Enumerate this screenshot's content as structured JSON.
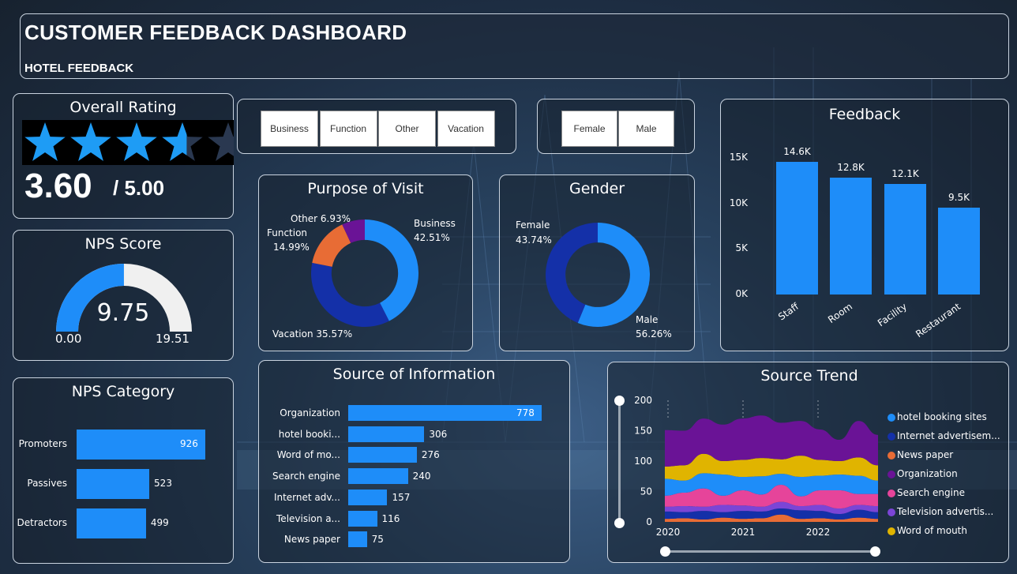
{
  "header": {
    "title": "CUSTOMER FEEDBACK DASHBOARD",
    "subtitle": "HOTEL FEEDBACK"
  },
  "overall_rating": {
    "title": "Overall Rating",
    "value_text": "3.60",
    "max_text": "/ 5.00",
    "stars": 3.6,
    "star_color": "#1e9cf5",
    "star_empty_color": "#2a3850"
  },
  "nps_score": {
    "title": "NPS Score",
    "value_text": "9.75",
    "min_text": "0.00",
    "max_text": "19.51",
    "fill_fraction": 0.4997,
    "fill_color": "#1e8df9",
    "track_color": "#f0f0f0"
  },
  "nps_category": {
    "title": "NPS Category",
    "items": [
      {
        "label": "Promoters",
        "value": 926,
        "value_text": "926"
      },
      {
        "label": "Passives",
        "value": 523,
        "value_text": "523"
      },
      {
        "label": "Detractors",
        "value": 499,
        "value_text": "499"
      }
    ]
  },
  "purpose_slicer": {
    "options": [
      "Business",
      "Function",
      "Other",
      "Vacation"
    ]
  },
  "gender_slicer": {
    "options": [
      "Female",
      "Male"
    ]
  },
  "purpose_of_visit": {
    "title": "Purpose of Visit",
    "segments": [
      {
        "name": "Business",
        "pct": 42.51,
        "label_name": "Business",
        "label_pct": "42.51%",
        "color": "#1e8df9"
      },
      {
        "name": "Vacation",
        "pct": 35.57,
        "label_name": "Vacation",
        "label_pct": "35.57%",
        "color": "#1430a8"
      },
      {
        "name": "Function",
        "pct": 14.99,
        "label_name": "Function",
        "label_pct": "14.99%",
        "color": "#e86c35"
      },
      {
        "name": "Other",
        "pct": 6.93,
        "label_name": "Other",
        "label_pct": "6.93%",
        "color": "#6a1396"
      }
    ]
  },
  "gender": {
    "title": "Gender",
    "segments": [
      {
        "name": "Male",
        "pct": 56.26,
        "label_name": "Male",
        "label_pct": "56.26%",
        "color": "#1e8df9"
      },
      {
        "name": "Female",
        "pct": 43.74,
        "label_name": "Female",
        "label_pct": "43.74%",
        "color": "#1430a8"
      }
    ]
  },
  "feedback": {
    "title": "Feedback",
    "yticks": [
      "15K",
      "10K",
      "5K",
      "0K"
    ],
    "bars": [
      {
        "category": "Staff",
        "value": 14.6,
        "label": "14.6K"
      },
      {
        "category": "Room",
        "value": 12.8,
        "label": "12.8K"
      },
      {
        "category": "Facility",
        "value": 12.1,
        "label": "12.1K"
      },
      {
        "category": "Restaurant",
        "value": 9.5,
        "label": "9.5K"
      }
    ]
  },
  "source_of_information": {
    "title": "Source of Information",
    "items": [
      {
        "label": "Organization",
        "value": 778,
        "value_text": "778"
      },
      {
        "label": "hotel booki...",
        "value": 306,
        "value_text": "306"
      },
      {
        "label": "Word of mo...",
        "value": 276,
        "value_text": "276"
      },
      {
        "label": "Search engine",
        "value": 240,
        "value_text": "240"
      },
      {
        "label": "Internet adv...",
        "value": 157,
        "value_text": "157"
      },
      {
        "label": "Television a...",
        "value": 116,
        "value_text": "116"
      },
      {
        "label": "News paper",
        "value": 75,
        "value_text": "75"
      }
    ]
  },
  "source_trend": {
    "title": "Source Trend",
    "yticks": [
      "200",
      "150",
      "100",
      "50",
      "0"
    ],
    "xticks": [
      "2020",
      "2021",
      "2022"
    ],
    "legend": [
      {
        "label": "hotel booking sites",
        "color": "#1e8df9"
      },
      {
        "label": "Internet advertisem...",
        "color": "#1430a8"
      },
      {
        "label": "News paper",
        "color": "#e86c35"
      },
      {
        "label": "Organization",
        "color": "#6a1396"
      },
      {
        "label": "Search engine",
        "color": "#e6449a"
      },
      {
        "label": "Television advertis...",
        "color": "#7b45d6"
      },
      {
        "label": "Word of mouth",
        "color": "#e0b400"
      }
    ]
  },
  "chart_data": [
    {
      "type": "bar",
      "title": "Feedback",
      "categories": [
        "Staff",
        "Room",
        "Facility",
        "Restaurant"
      ],
      "values": [
        14.6,
        12.8,
        12.1,
        9.5
      ],
      "ylim": [
        0,
        15
      ],
      "unit": "K",
      "grid": false
    },
    {
      "type": "pie",
      "title": "Purpose of Visit",
      "categories": [
        "Business",
        "Vacation",
        "Function",
        "Other"
      ],
      "values": [
        42.51,
        35.57,
        14.99,
        6.93
      ]
    },
    {
      "type": "pie",
      "title": "Gender",
      "categories": [
        "Male",
        "Female"
      ],
      "values": [
        56.26,
        43.74
      ]
    },
    {
      "type": "bar",
      "title": "Source of Information",
      "categories": [
        "Organization",
        "hotel booki...",
        "Word of mo...",
        "Search engine",
        "Internet adv...",
        "Television a...",
        "News paper"
      ],
      "values": [
        778,
        306,
        276,
        240,
        157,
        116,
        75
      ]
    },
    {
      "type": "bar",
      "title": "NPS Category",
      "categories": [
        "Promoters",
        "Passives",
        "Detractors"
      ],
      "values": [
        926,
        523,
        499
      ]
    },
    {
      "type": "area",
      "title": "Source Trend",
      "ylim": [
        0,
        200
      ],
      "legend_position": "right",
      "series_order": [
        "News paper",
        "Internet advertisem...",
        "Television advertis...",
        "Search engine",
        "hotel booking sites",
        "Word of mouth",
        "Organization"
      ],
      "x": [
        "2020-01",
        "2020-04",
        "2020-07",
        "2020-10",
        "2021-01",
        "2021-04",
        "2021-07",
        "2021-10",
        "2022-01",
        "2022-04",
        "2022-07",
        "2022-10"
      ],
      "series": [
        {
          "name": "News paper",
          "values": [
            5,
            6,
            4,
            7,
            5,
            6,
            12,
            5,
            6,
            4,
            7,
            5
          ]
        },
        {
          "name": "Internet advertisem...",
          "values": [
            12,
            10,
            14,
            9,
            13,
            11,
            10,
            14,
            12,
            9,
            13,
            11
          ]
        },
        {
          "name": "Television advertis...",
          "values": [
            8,
            10,
            7,
            12,
            9,
            8,
            11,
            7,
            10,
            9,
            8,
            10
          ]
        },
        {
          "name": "Search engine",
          "values": [
            18,
            22,
            30,
            15,
            25,
            20,
            28,
            16,
            24,
            30,
            18,
            20
          ]
        },
        {
          "name": "hotel booking sites",
          "values": [
            28,
            20,
            25,
            35,
            22,
            30,
            18,
            32,
            24,
            26,
            30,
            22
          ]
        },
        {
          "name": "Word of mouth",
          "values": [
            20,
            25,
            32,
            22,
            28,
            30,
            24,
            35,
            26,
            22,
            30,
            25
          ]
        },
        {
          "name": "Organization",
          "values": [
            60,
            57,
            58,
            60,
            68,
            70,
            60,
            57,
            50,
            35,
            60,
            50
          ]
        }
      ]
    }
  ]
}
